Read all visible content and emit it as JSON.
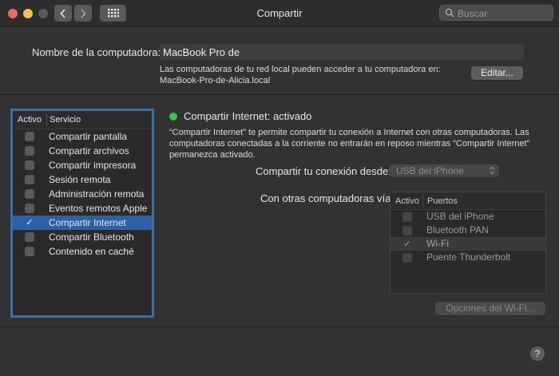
{
  "window": {
    "title": "Compartir",
    "search_placeholder": "Buscar",
    "colors": {
      "close": "#ed6a5e",
      "minimize": "#f5bf4f",
      "zoom": "#5a5a5a"
    }
  },
  "computer_name": {
    "label": "Nombre de la computadora:",
    "value": "MacBook Pro de",
    "info_line1": "Las computadoras de tu red local pueden acceder a tu computadora en:",
    "info_line2": "MacBook-Pro-de-Alicia.local",
    "edit_button": "Editar..."
  },
  "services": {
    "header_active": "Activo",
    "header_service": "Servicio",
    "items": [
      {
        "label": "Compartir pantalla",
        "checked": false,
        "selected": false
      },
      {
        "label": "Compartir archivos",
        "checked": false,
        "selected": false
      },
      {
        "label": "Compartir impresora",
        "checked": false,
        "selected": false
      },
      {
        "label": "Sesión remota",
        "checked": false,
        "selected": false
      },
      {
        "label": "Administración remota",
        "checked": false,
        "selected": false
      },
      {
        "label": "Eventos remotos Apple",
        "checked": false,
        "selected": false
      },
      {
        "label": "Compartir Internet",
        "checked": true,
        "selected": true
      },
      {
        "label": "Compartir Bluetooth",
        "checked": false,
        "selected": false
      },
      {
        "label": "Contenido en caché",
        "checked": false,
        "selected": false
      }
    ],
    "check_mark": "✓"
  },
  "detail": {
    "status": "Compartir Internet: activado",
    "status_color": "#3dc244",
    "description_line1": "“Compartir Internet” te permite compartir tu conexión a Internet con otras computadoras. Las",
    "description_line2": "computadoras conectadas a la corriente no entrarán en reposo mientras “Compartir Internet”",
    "description_line3": "permanezca activado.",
    "share_from_label": "Compartir tu conexión desde:",
    "share_from_value": "USB del iPhone",
    "to_computers_label": "Con otras computadoras vía:",
    "ports_header_active": "Activo",
    "ports_header_ports": "Puertos",
    "ports": [
      {
        "label": "USB del iPhone",
        "checked": false
      },
      {
        "label": "Bluetooth PAN",
        "checked": false
      },
      {
        "label": "Wi-Fi",
        "checked": true
      },
      {
        "label": "Puente Thunderbolt",
        "checked": false
      }
    ],
    "wifi_options_button": "Opciones del Wi-Fi..."
  },
  "help_label": "?"
}
